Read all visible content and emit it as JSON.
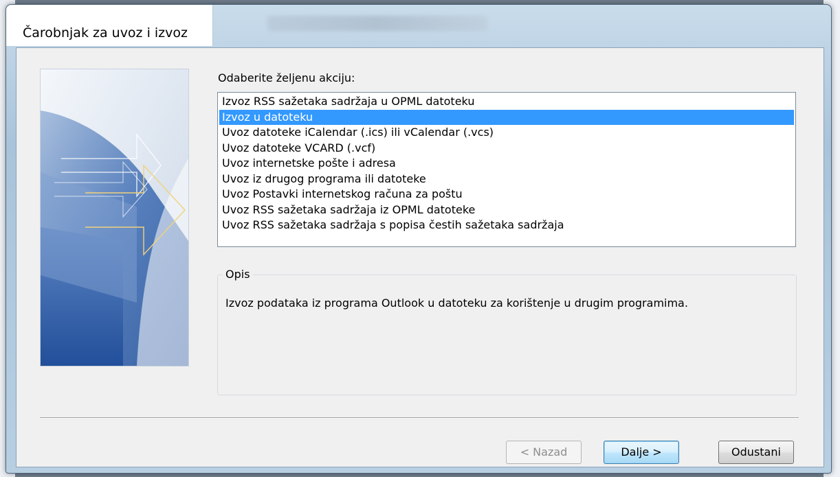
{
  "window": {
    "title": "Čarobnjak za uvoz i izvoz"
  },
  "prompt": "Odaberite željenu akciju:",
  "actions": [
    "Izvoz RSS sažetaka sadržaja u OPML datoteku",
    "Izvoz u datoteku",
    "Uvoz datoteke iCalendar (.ics) ili vCalendar (.vcs)",
    "Uvoz datoteke VCARD (.vcf)",
    "Uvoz internetske pošte i adresa",
    "Uvoz iz drugog programa ili datoteke",
    "Uvoz Postavki internetskog računa za poštu",
    "Uvoz RSS sažetaka sadržaja iz OPML datoteke",
    "Uvoz RSS sažetaka sadržaja s popisa čestih sažetaka sadržaja"
  ],
  "selected_action": "Izvoz u datoteku",
  "description": {
    "legend": "Opis",
    "text": "Izvoz podataka iz programa Outlook u datoteku za korištenje u drugim programima."
  },
  "buttons": {
    "back": "< Nazad",
    "next": "Dalje >",
    "cancel": "Odustani"
  },
  "colors": {
    "selection": "#3399ff",
    "default_button": "#a7d9f5"
  }
}
